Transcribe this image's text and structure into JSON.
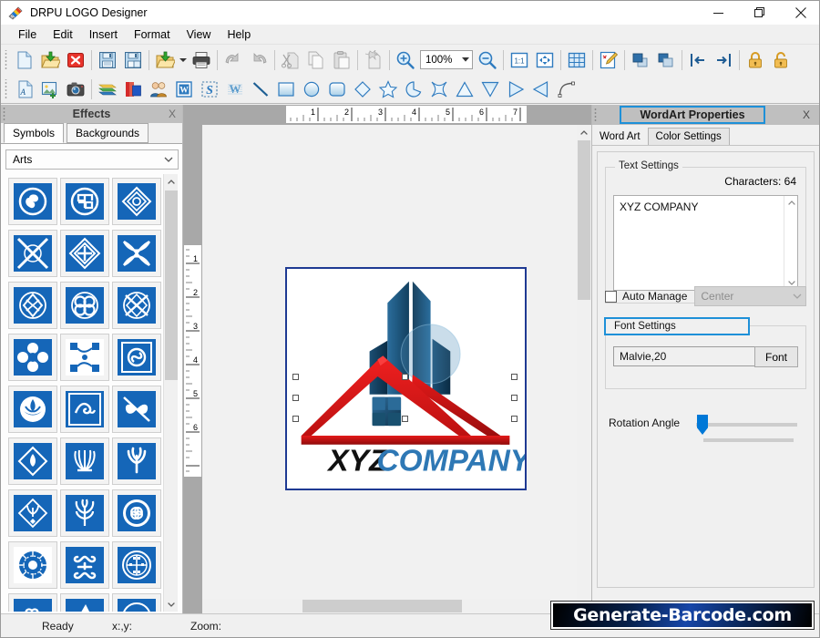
{
  "window": {
    "title": "DRPU LOGO Designer",
    "app_icon": "logo-swatch-icon",
    "minimize": "—",
    "maximize": "❐",
    "close": "✕"
  },
  "menu": {
    "items": [
      {
        "label": "File"
      },
      {
        "label": "Edit"
      },
      {
        "label": "Insert"
      },
      {
        "label": "Format"
      },
      {
        "label": "View"
      },
      {
        "label": "Help"
      }
    ]
  },
  "toolbar_top": {
    "items": [
      {
        "name": "new-document-icon"
      },
      {
        "name": "open-document-icon"
      },
      {
        "name": "close-document-icon"
      },
      {
        "name": "save-icon"
      },
      {
        "name": "save-as-icon"
      },
      {
        "name": "export-icon"
      },
      {
        "name": "export-dropdown-icon"
      },
      {
        "name": "print-icon"
      },
      {
        "name": "undo-icon"
      },
      {
        "name": "redo-icon"
      },
      {
        "name": "cut-icon"
      },
      {
        "name": "copy-icon"
      },
      {
        "name": "paste-icon"
      },
      {
        "name": "delete-icon"
      },
      {
        "name": "zoom-in-icon"
      },
      {
        "name": "zoom-out-icon"
      },
      {
        "name": "actual-size-icon"
      },
      {
        "name": "fit-page-icon"
      },
      {
        "name": "grid-icon"
      },
      {
        "name": "edit-design-icon"
      },
      {
        "name": "bring-front-icon"
      },
      {
        "name": "send-back-icon"
      },
      {
        "name": "align-left-icon"
      },
      {
        "name": "align-right-icon"
      },
      {
        "name": "lock-icon"
      },
      {
        "name": "unlock-icon"
      }
    ],
    "zoom_value": "100%"
  },
  "toolbar_bottom": {
    "items": [
      {
        "name": "insert-text-icon"
      },
      {
        "name": "insert-image-icon"
      },
      {
        "name": "capture-image-icon"
      },
      {
        "name": "layers-icon"
      },
      {
        "name": "color-palette-icon"
      },
      {
        "name": "insert-people-icon"
      },
      {
        "name": "insert-word-icon"
      },
      {
        "name": "signature-icon"
      },
      {
        "name": "watermark-icon"
      },
      {
        "name": "line-tool-icon"
      },
      {
        "name": "rectangle-tool-icon"
      },
      {
        "name": "ellipse-tool-icon"
      },
      {
        "name": "rounded-rect-tool-icon"
      },
      {
        "name": "diamond-tool-icon"
      },
      {
        "name": "star-tool-icon"
      },
      {
        "name": "pie-tool-icon"
      },
      {
        "name": "four-point-star-icon"
      },
      {
        "name": "triangle-tool-icon"
      },
      {
        "name": "inverted-triangle-icon"
      },
      {
        "name": "right-triangle-icon"
      },
      {
        "name": "left-triangle-icon"
      },
      {
        "name": "arc-tool-icon"
      }
    ]
  },
  "left_panel": {
    "title": "Effects",
    "close_label": "X",
    "tabs": [
      {
        "label": "Symbols",
        "active": true
      },
      {
        "label": "Backgrounds",
        "active": false
      }
    ],
    "category": "Arts",
    "symbols_count": 27
  },
  "workspace": {
    "h_ruler_labels": [
      "1",
      "2",
      "3",
      "4",
      "5",
      "6",
      "7"
    ],
    "v_ruler_labels": [
      "1",
      "2",
      "3",
      "4",
      "5",
      "6"
    ],
    "logo": {
      "company_text_part1": "XYZ",
      "company_text_part2": "COMPANY",
      "building_color": "#1a4f7a",
      "building_color_dark": "#0d2f4d",
      "roof_color": "#e01b1b",
      "roof_color_dark": "#9e0d0d",
      "text_color_dark": "#111111",
      "text_color_blue": "#2e78b5"
    }
  },
  "right_panel": {
    "title": "WordArt Properties",
    "close_label": "X",
    "tabs": [
      {
        "label": "Word Art",
        "active": true
      },
      {
        "label": "Color Settings",
        "active": false
      }
    ],
    "text_settings": {
      "group_label": "Text Settings",
      "characters_label": "Characters: 64",
      "textarea_value": "XYZ COMPANY",
      "auto_manage_label": "Auto Manage",
      "auto_manage_checked": false,
      "alignment_value": "Center"
    },
    "font_settings": {
      "group_label": "Font Settings",
      "font_value": "Malvie,20",
      "font_button_label": "Font"
    },
    "rotation": {
      "label": "Rotation Angle",
      "value": 0
    },
    "highlight_color": "#1e90d8"
  },
  "status_bar": {
    "ready": "Ready",
    "coords": "x:,y:",
    "zoom": "Zoom:"
  },
  "watermark": {
    "text": "Generate-Barcode.com"
  }
}
